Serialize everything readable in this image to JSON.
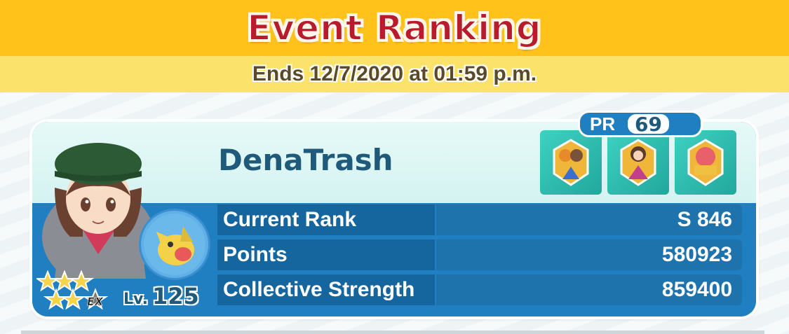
{
  "header": {
    "title": "Event Ranking",
    "subtitle": "Ends 12/7/2020 at 01:59 p.m."
  },
  "player": {
    "name": "DenaTrash",
    "pr_label": "PR",
    "pr_value": "69",
    "level_label": "Lv.",
    "level": "125",
    "star_rating": "5★ EX",
    "stats": [
      {
        "label": "Current Rank",
        "value": "S  846"
      },
      {
        "label": "Points",
        "value": "580923"
      },
      {
        "label": "Collective Strength",
        "value": "859400"
      }
    ]
  },
  "colors": {
    "header_bar": "#ffc21a",
    "title_red": "#b81c2c",
    "card_blue": "#1f7fc0",
    "name_text": "#1f5a7a"
  },
  "icons": {
    "trainer": "trainer-portrait-icon",
    "partner": "pokemon-partner-icon",
    "emblems": [
      "team-emblem-1-icon",
      "team-emblem-2-icon",
      "team-emblem-3-icon"
    ]
  }
}
